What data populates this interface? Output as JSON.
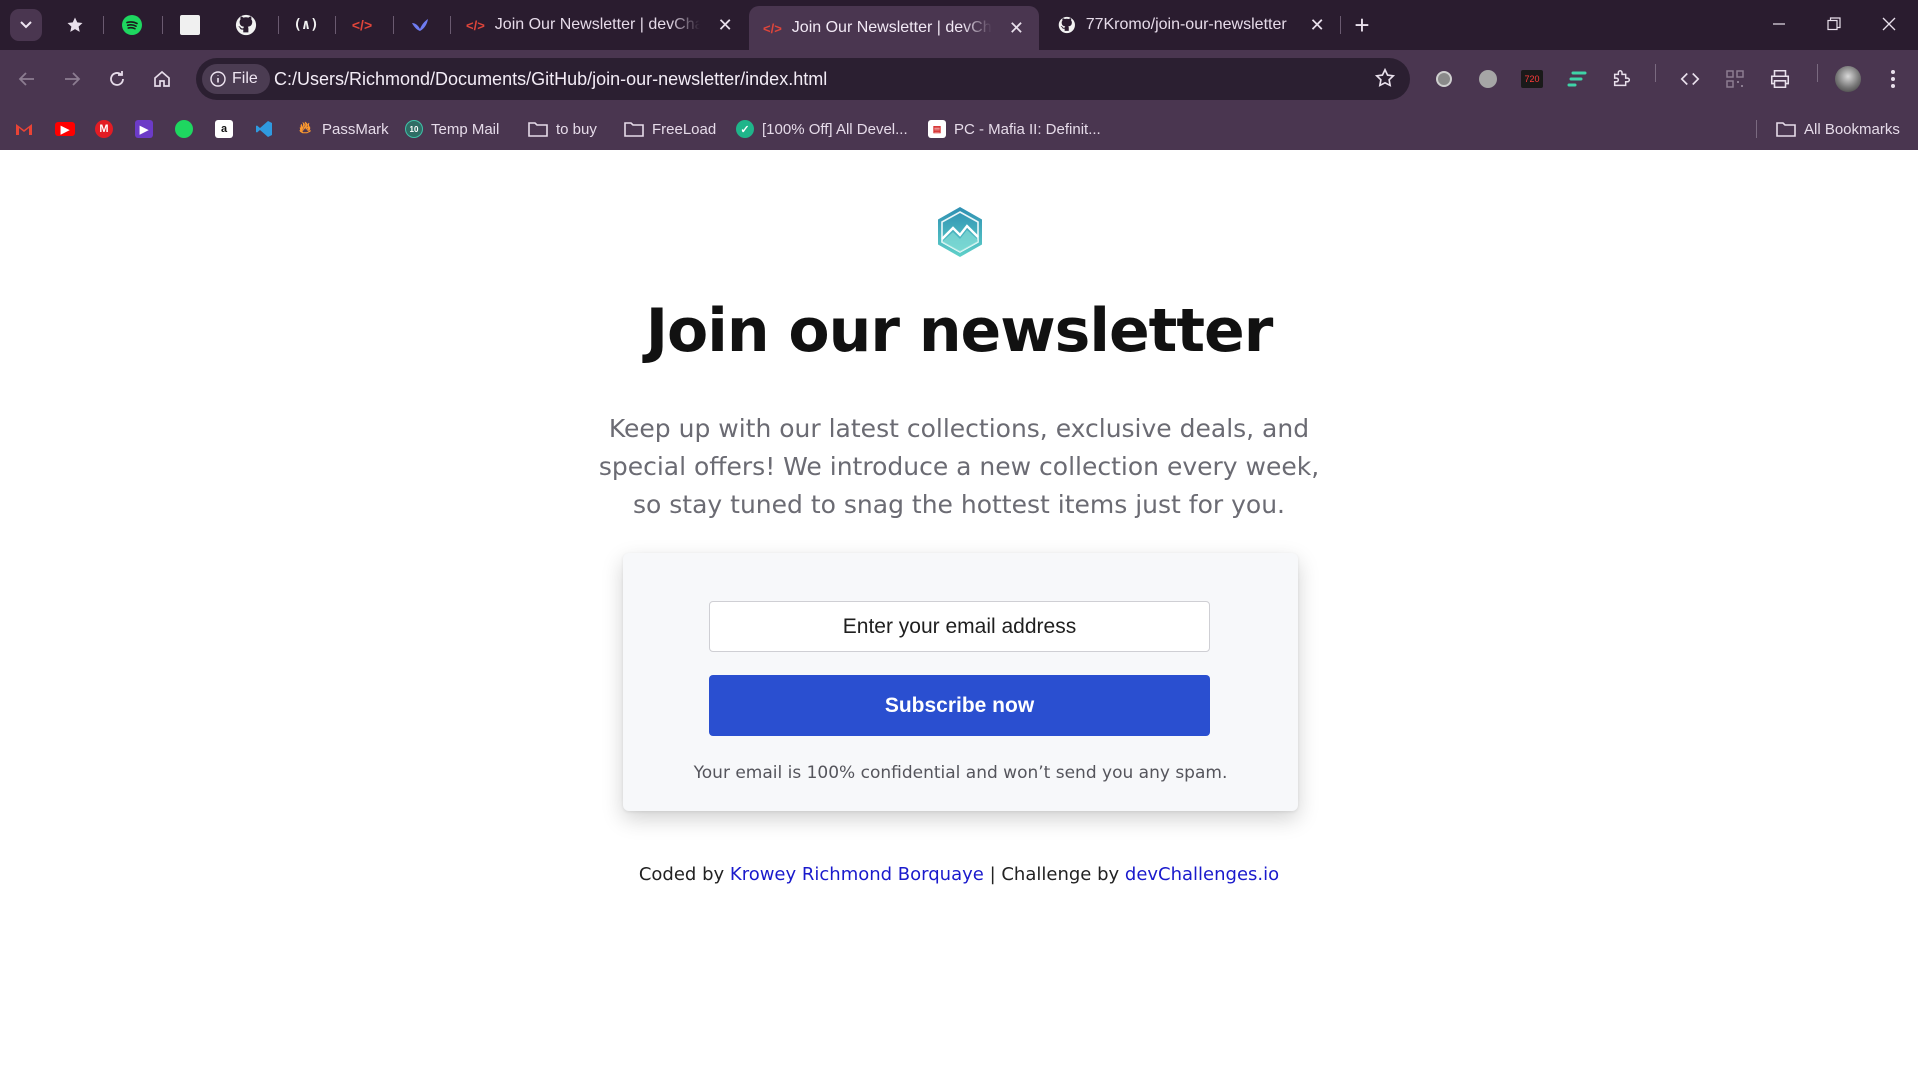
{
  "browser": {
    "tabs": [
      {
        "title": "Join Our Newsletter | devChallenges",
        "favicon": "devchallenges-icon",
        "active": false
      },
      {
        "title": "Join Our Newsletter | devChallenges",
        "favicon": "devchallenges-icon",
        "active": true
      },
      {
        "title": "77Kromo/join-our-newsletter",
        "favicon": "github-icon",
        "active": false
      }
    ],
    "address": {
      "scheme_chip": "File",
      "url": "C:/Users/Richmond/Documents/GitHub/join-our-newsletter/index.html"
    },
    "extension_badge": "720",
    "bookmarks": [
      {
        "label": "PassMark",
        "icon": "flame-icon"
      },
      {
        "label": "Temp Mail",
        "icon": "temp-mail-icon"
      },
      {
        "label": "to buy",
        "icon": "folder-icon"
      },
      {
        "label": "FreeLoad",
        "icon": "folder-icon"
      },
      {
        "label": "[100% Off] All Devel...",
        "icon": "coupon-icon"
      },
      {
        "label": "PC - Mafia II: Definit...",
        "icon": "pdf-icon"
      }
    ],
    "all_bookmarks_label": "All Bookmarks",
    "colors": {
      "frame": "#2a1c2f",
      "toolbar": "#4a3650",
      "omnibox": "#2b1f31"
    }
  },
  "page": {
    "heading": "Join our newsletter",
    "intro": "Keep up with our latest collections, exclusive deals, and special offers! We introduce a new collection every week, so stay tuned to snag the hottest items just for you.",
    "form": {
      "email_placeholder": "Enter your email address",
      "submit_label": "Subscribe now",
      "note": "Your email is 100% confidential and won’t send you any spam."
    },
    "footer": {
      "prefix": "Coded by",
      "author": "Krowey Richmond Borquaye",
      "separator": "| Challenge by",
      "challenge_site": "devChallenges.io"
    },
    "colors": {
      "button": "#2a4fd0",
      "link": "#1a1acc",
      "heading": "#111111",
      "muted": "#6b6b73"
    }
  }
}
